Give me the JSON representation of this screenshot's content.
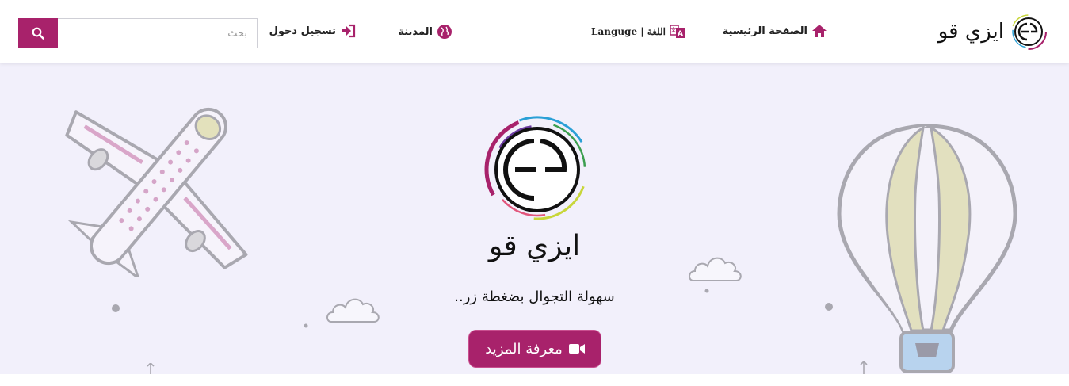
{
  "brand": {
    "name": "ايزي قو"
  },
  "nav": {
    "home": "الصفحة الرئيسية",
    "language": "Languge | اللغة",
    "city": "المدينة",
    "login": "تسجيل دخول"
  },
  "search": {
    "placeholder": "بحث"
  },
  "hero": {
    "title": "ايزي قو",
    "tagline": "سهولة التجوال بضغطة زر..",
    "cta_label": "معرفة المزيد"
  },
  "colors": {
    "accent": "#a8226b",
    "hero_bg": "#f2f0fb"
  }
}
